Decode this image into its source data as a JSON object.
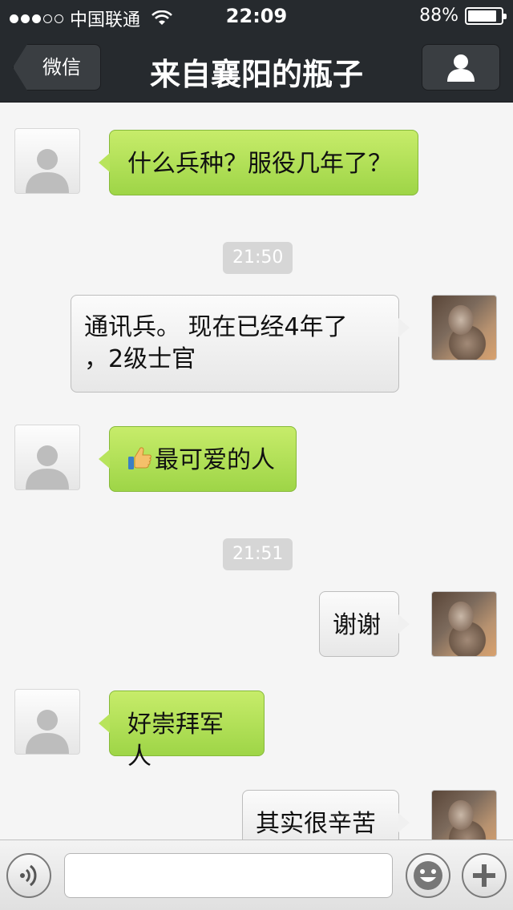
{
  "status_bar": {
    "signal_filled": 3,
    "signal_empty": 2,
    "carrier": "中国联通",
    "wifi_icon": "wifi-icon",
    "time": "22:09",
    "battery_percent": "88%",
    "battery_level": 0.88
  },
  "nav": {
    "back_label": "微信",
    "title": "来自襄阳的瓶子",
    "profile_icon": "person-icon"
  },
  "messages": [
    {
      "type": "text",
      "side": "in",
      "text": "什么兵种？服役几年了？"
    },
    {
      "type": "time",
      "text": "21:50"
    },
    {
      "type": "text",
      "side": "out",
      "text_line1": "通讯兵。 现在已经4年了",
      "text_line2": "，2级士官"
    },
    {
      "type": "text",
      "side": "in",
      "emoji": "thumbs-up-icon",
      "text": "最可爱的人"
    },
    {
      "type": "time",
      "text": "21:51"
    },
    {
      "type": "text",
      "side": "out",
      "text": "谢谢"
    },
    {
      "type": "text",
      "side": "in",
      "text": "好崇拜军人"
    },
    {
      "type": "text",
      "side": "out",
      "text": "其实很辛苦"
    }
  ],
  "input_bar": {
    "voice_icon": "voice-icon",
    "input_value": "",
    "emoji_icon": "smiley-icon",
    "plus_icon": "plus-icon"
  },
  "colors": {
    "header_bg": "#262a2e",
    "incoming_bubble": "#a8dc50",
    "outgoing_bubble": "#f0f0f0",
    "chat_bg": "#f5f5f5"
  }
}
